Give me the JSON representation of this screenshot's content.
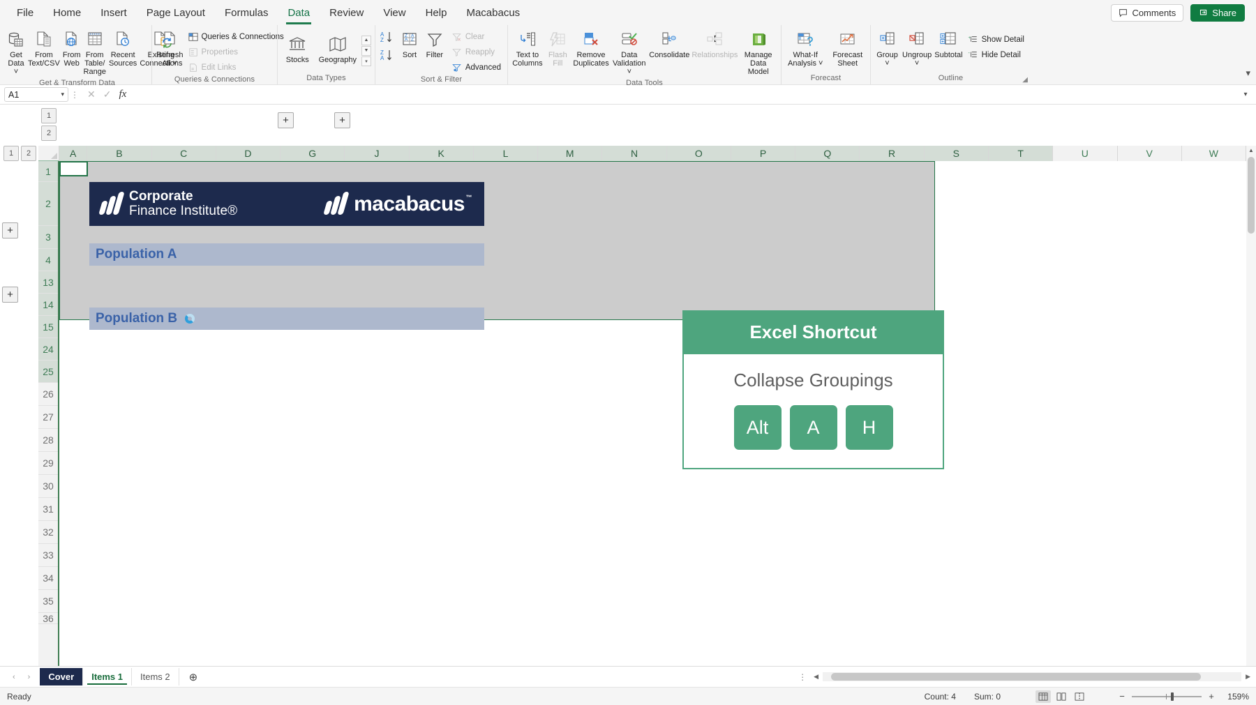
{
  "app": {
    "ribbon_tabs": [
      "File",
      "Home",
      "Insert",
      "Page Layout",
      "Formulas",
      "Data",
      "Review",
      "View",
      "Help",
      "Macabacus"
    ],
    "active_tab": "Data",
    "comments_label": "Comments",
    "share_label": "Share",
    "accent_green": "#107c41",
    "card_green": "#4ea57e",
    "navy": "#1d2a4d"
  },
  "ribbon": {
    "groups": [
      {
        "label": "Get & Transform Data",
        "buttons": [
          {
            "label": "Get\nData ˅",
            "name": "get-data-button",
            "disabled": false
          },
          {
            "label": "From\nText/CSV",
            "name": "from-text-csv-button",
            "disabled": false
          },
          {
            "label": "From\nWeb",
            "name": "from-web-button",
            "disabled": false
          },
          {
            "label": "From Table/\nRange",
            "name": "from-table-range-button",
            "disabled": false
          },
          {
            "label": "Recent\nSources",
            "name": "recent-sources-button",
            "disabled": false
          },
          {
            "label": "Existing\nConnections",
            "name": "existing-connections-button",
            "disabled": false
          }
        ]
      },
      {
        "label": "Queries & Connections",
        "big": [
          {
            "label": "Refresh\nAll ˅",
            "name": "refresh-all-button"
          }
        ],
        "small": [
          {
            "label": "Queries & Connections",
            "name": "queries-connections-button",
            "disabled": false
          },
          {
            "label": "Properties",
            "name": "properties-button",
            "disabled": true
          },
          {
            "label": "Edit Links",
            "name": "edit-links-button",
            "disabled": true
          }
        ]
      },
      {
        "label": "Data Types",
        "buttons": [
          {
            "label": "Stocks",
            "name": "stocks-button",
            "disabled": false
          },
          {
            "label": "Geography",
            "name": "geography-button",
            "disabled": false
          }
        ]
      },
      {
        "label": "Sort & Filter",
        "buttons": [
          {
            "label": "Sort",
            "name": "sort-button",
            "disabled": false
          },
          {
            "label": "Filter",
            "name": "filter-button",
            "disabled": false
          }
        ],
        "small": [
          {
            "label": "Clear",
            "name": "clear-button",
            "disabled": true
          },
          {
            "label": "Reapply",
            "name": "reapply-button",
            "disabled": true
          },
          {
            "label": "Advanced",
            "name": "advanced-button",
            "disabled": false
          }
        ]
      },
      {
        "label": "Data Tools",
        "buttons": [
          {
            "label": "Text to\nColumns",
            "name": "text-to-columns-button",
            "disabled": false
          },
          {
            "label": "Flash\nFill",
            "name": "flash-fill-button",
            "disabled": true
          },
          {
            "label": "Remove\nDuplicates",
            "name": "remove-duplicates-button",
            "disabled": false
          },
          {
            "label": "Data\nValidation ˅",
            "name": "data-validation-button",
            "disabled": false
          },
          {
            "label": "Consolidate",
            "name": "consolidate-button",
            "disabled": false
          },
          {
            "label": "Relationships",
            "name": "relationships-button",
            "disabled": true
          },
          {
            "label": "Manage\nData Model",
            "name": "manage-data-model-button",
            "disabled": false
          }
        ]
      },
      {
        "label": "Forecast",
        "buttons": [
          {
            "label": "What-If\nAnalysis ˅",
            "name": "what-if-analysis-button",
            "disabled": false
          },
          {
            "label": "Forecast\nSheet",
            "name": "forecast-sheet-button",
            "disabled": false
          }
        ]
      },
      {
        "label": "Outline",
        "buttons": [
          {
            "label": "Group\n˅",
            "name": "group-button",
            "disabled": false
          },
          {
            "label": "Ungroup\n˅",
            "name": "ungroup-button",
            "disabled": false
          },
          {
            "label": "Subtotal",
            "name": "subtotal-button",
            "disabled": false
          }
        ],
        "small": [
          {
            "label": "Show Detail",
            "name": "show-detail-button",
            "disabled": false
          },
          {
            "label": "Hide Detail",
            "name": "hide-detail-button",
            "disabled": false
          }
        ]
      }
    ]
  },
  "formula_bar": {
    "name_box": "A1",
    "formula": "",
    "cancel_icon": "✕",
    "enter_icon": "✓",
    "fx_icon": "fx"
  },
  "grid": {
    "columns": [
      "A",
      "B",
      "C",
      "D",
      "G",
      "J",
      "K",
      "L",
      "M",
      "N",
      "O",
      "P",
      "Q",
      "R",
      "S",
      "T",
      "U",
      "V",
      "W"
    ],
    "rows": [
      "1",
      "2",
      "3",
      "4",
      "13",
      "14",
      "15",
      "24",
      "25",
      "26",
      "27",
      "28",
      "29",
      "30",
      "31",
      "32",
      "33",
      "34",
      "35",
      "36"
    ],
    "outline_levels_col": [
      "1",
      "2"
    ],
    "outline_levels_row": [
      "1",
      "2"
    ],
    "expand_button": "+",
    "banner": {
      "cfi_line1": "Corporate",
      "cfi_line2": "Finance Institute®",
      "macabacus": "macabacus",
      "macabacus_tm": "™"
    },
    "section_a": "Population A",
    "section_b": "Population B"
  },
  "shortcut_card": {
    "title": "Excel Shortcut",
    "action": "Collapse Groupings",
    "keys": [
      "Alt",
      "A",
      "H"
    ]
  },
  "sheet_tabs": {
    "tabs": [
      {
        "label": "Cover",
        "state": "cover"
      },
      {
        "label": "Items 1",
        "state": "active"
      },
      {
        "label": "Items 2",
        "state": "plain"
      }
    ],
    "add_sheet": "⊕",
    "prev_icon": "‹",
    "next_icon": "›"
  },
  "status_bar": {
    "mode": "Ready",
    "count": "Count: 4",
    "sum": "Sum: 0",
    "zoom": "159%",
    "zoom_out": "−",
    "zoom_in": "+"
  }
}
